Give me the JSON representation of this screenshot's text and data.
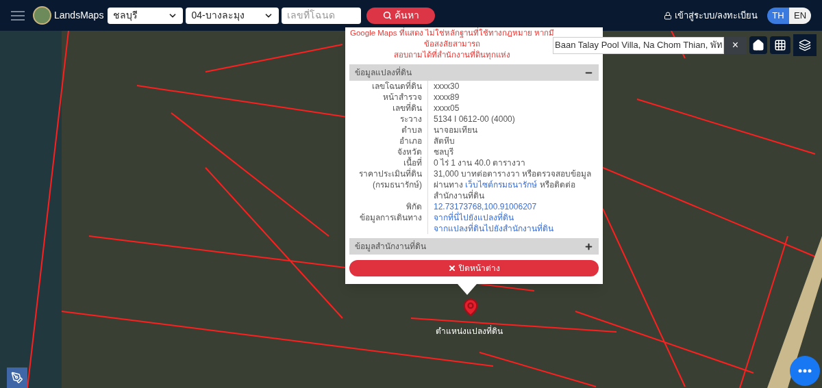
{
  "header": {
    "logo_text": "LandsMaps",
    "province": "ชลบุรี",
    "district": "04-บางละมุง",
    "deed_field": {
      "placeholder": "เลขที่โฉนด"
    },
    "search_button": "ค้นหา",
    "login_link": "เข้าสู่ระบบ/ลงทะเบียน",
    "languages": [
      {
        "label": "TH",
        "selected": true
      },
      {
        "label": "EN",
        "selected": false
      }
    ]
  },
  "map_search": {
    "value": "Baan Talay Pool Villa, Na Chom Thian, พัท",
    "clear": "×"
  },
  "popup": {
    "notice": [
      "Google Maps ที่แสดง ไม่ใช่หลักฐานที่ใช้ทางกฎหมาย หากมีข้อสงสัยสามารถ",
      "สอบถามได้ที่สำนักงานที่ดินทุกแห่ง"
    ],
    "sections": [
      {
        "title": "ข้อมูลแปลงที่ดิน",
        "expanded": true,
        "rows": [
          {
            "label": "เลขโฉนดที่ดิน",
            "lines": [
              [
                {
                  "kind": "text",
                  "text": "xxxx30"
                }
              ]
            ]
          },
          {
            "label": "หน้าสำรวจ",
            "lines": [
              [
                {
                  "kind": "text",
                  "text": "xxxx89"
                }
              ]
            ]
          },
          {
            "label": "เลขที่ดิน",
            "lines": [
              [
                {
                  "kind": "text",
                  "text": "xxxx05"
                }
              ]
            ]
          },
          {
            "label": "ระวาง",
            "lines": [
              [
                {
                  "kind": "text",
                  "text": "5134 I 0612-00 (4000)"
                }
              ]
            ]
          },
          {
            "label": "ตำบล",
            "lines": [
              [
                {
                  "kind": "text",
                  "text": "นาจอมเทียน"
                }
              ]
            ]
          },
          {
            "label": "อำเภอ",
            "lines": [
              [
                {
                  "kind": "text",
                  "text": "สัตหีบ"
                }
              ]
            ]
          },
          {
            "label": "จังหวัด",
            "lines": [
              [
                {
                  "kind": "text",
                  "text": "ชลบุรี"
                }
              ]
            ]
          },
          {
            "label": "เนื้อที่",
            "lines": [
              [
                {
                  "kind": "text",
                  "text": "0 ไร่ 1 งาน 40.0 ตารางวา"
                }
              ]
            ]
          },
          {
            "label": "ราคาประเมินที่ดิน (กรมธนารักษ์)",
            "lines": [
              [
                {
                  "kind": "text",
                  "text": "31,000 บาทต่อตารางวา หรือตรวจสอบข้อมูลผ่านทาง "
                },
                {
                  "kind": "link",
                  "text": "เว็บไซต์กรมธนารักษ์"
                },
                {
                  "kind": "text",
                  "text": " หรือติดต่อสำนักงานที่ดิน"
                }
              ]
            ]
          },
          {
            "label": "พิกัด",
            "lines": [
              [
                {
                  "kind": "link",
                  "text": "12.73173768,100.91006207"
                }
              ]
            ]
          },
          {
            "label": "ข้อมูลการเดินทาง",
            "lines": [
              [
                {
                  "kind": "link",
                  "text": "จากที่นี่ไปยังแปลงที่ดิน"
                }
              ],
              [
                {
                  "kind": "link",
                  "text": "จากแปลงที่ดินไปยังสำนักงานที่ดิน"
                }
              ]
            ]
          }
        ]
      },
      {
        "title": "ข้อมูลสำนักงานที่ดิน",
        "expanded": false
      }
    ],
    "close_button": "ปิดหน้าต่าง"
  },
  "marker": {
    "label": "ตำแหน่งแปลงที่ดิน"
  }
}
